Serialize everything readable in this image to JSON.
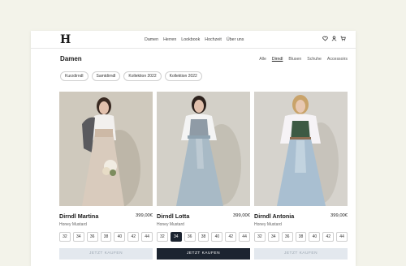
{
  "logo": "H",
  "nav": [
    "Damen",
    "Herren",
    "Lookbook",
    "Hochzeit",
    "Über uns"
  ],
  "header_icons": [
    "heart-icon",
    "user-icon",
    "cart-icon"
  ],
  "page_title": "Damen",
  "filters": [
    "Alle",
    "Dirndl",
    "Blusen",
    "Schuhe",
    "Accessoirs"
  ],
  "active_filter": "Dirndl",
  "chips": [
    "Kurzdirndl",
    "Samtdirndl",
    "Kollektion 2022",
    "Kollektion 2022"
  ],
  "products": [
    {
      "name": "Dirndl Martina",
      "price": "399,00€",
      "brand": "Honey Mustard",
      "sizes": [
        "32",
        "34",
        "36",
        "38",
        "40",
        "42",
        "44"
      ],
      "selected_size": null,
      "button": "JETZT KAUFEN",
      "button_state": "disabled"
    },
    {
      "name": "Dirndl Lotta",
      "price": "399,00€",
      "brand": "Honey Mustard",
      "sizes": [
        "32",
        "34",
        "36",
        "38",
        "40",
        "42",
        "44"
      ],
      "selected_size": "34",
      "button": "JETZT KAUFEN",
      "button_state": "enabled"
    },
    {
      "name": "Dirndl Antonia",
      "price": "399,00€",
      "brand": "Honey Mustard",
      "sizes": [
        "32",
        "34",
        "36",
        "38",
        "40",
        "42",
        "44"
      ],
      "selected_size": null,
      "button": "JETZT KAUFEN",
      "button_state": "disabled"
    }
  ],
  "colors": {
    "page_background": "#f3f3ea",
    "accent_dark": "#1c2430",
    "button_disabled": "#e3e8ee"
  }
}
